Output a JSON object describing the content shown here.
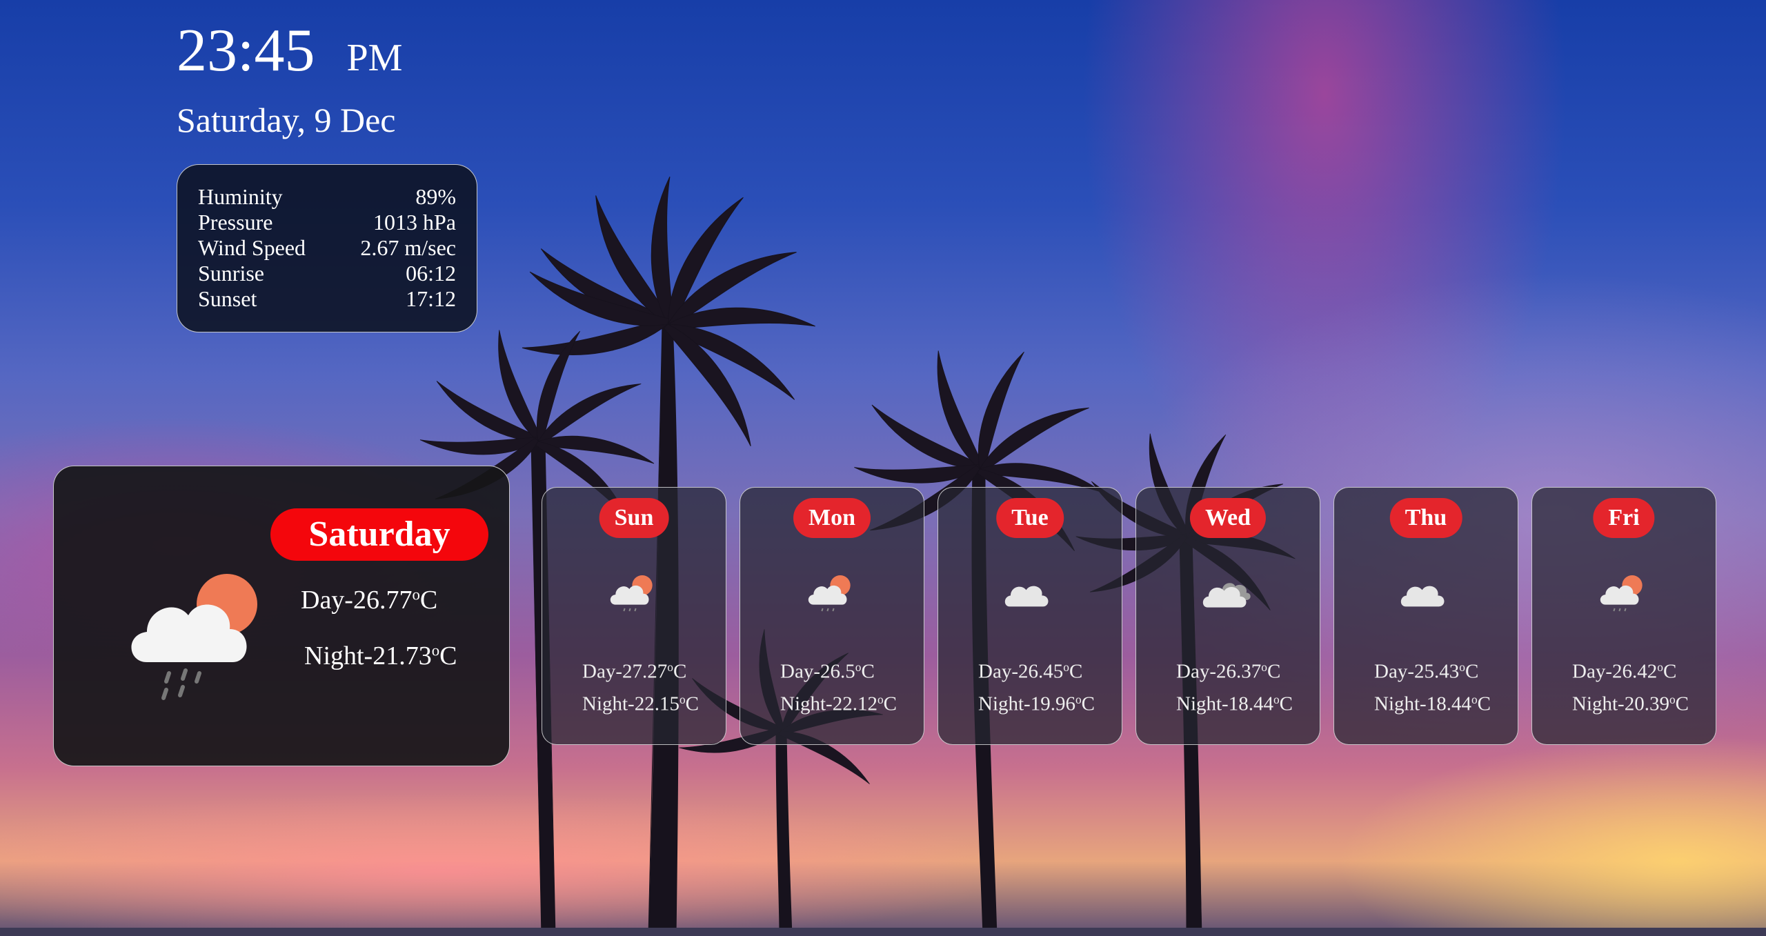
{
  "clock": {
    "time": "23:45",
    "ampm": "PM",
    "date": "Saturday, 9 Dec"
  },
  "stats": [
    {
      "label": "Huminity",
      "value": "89%"
    },
    {
      "label": "Pressure",
      "value": "1013 hPa"
    },
    {
      "label": "Wind Speed",
      "value": "2.67 m/sec"
    },
    {
      "label": "Sunrise",
      "value": "06:12"
    },
    {
      "label": "Sunset",
      "value": "17:12"
    }
  ],
  "today": {
    "day": "Saturday",
    "day_temp": "Day-26.77",
    "night_temp": "Night-21.73",
    "unit_deg": "o",
    "unit_c": "C",
    "icon": "cloud-sun-rain-icon"
  },
  "forecast": [
    {
      "day": "Sun",
      "day_temp": "Day-27.27",
      "night_temp": "Night-22.15",
      "icon": "cloud-sun-rain-icon"
    },
    {
      "day": "Mon",
      "day_temp": "Day-26.5",
      "night_temp": "Night-22.12",
      "icon": "cloud-sun-rain-icon"
    },
    {
      "day": "Tue",
      "day_temp": "Day-26.45",
      "night_temp": "Night-19.96",
      "icon": "cloud-icon"
    },
    {
      "day": "Wed",
      "day_temp": "Day-26.37",
      "night_temp": "Night-18.44",
      "icon": "clouds-icon"
    },
    {
      "day": "Thu",
      "day_temp": "Day-25.43",
      "night_temp": "Night-18.44",
      "icon": "cloud-icon"
    },
    {
      "day": "Fri",
      "day_temp": "Day-26.42",
      "night_temp": "Night-20.39",
      "icon": "cloud-sun-rain-icon"
    }
  ],
  "colors": {
    "badge_today": "#f4060c",
    "badge": "#e4252c",
    "sun": "#ef7a55"
  }
}
